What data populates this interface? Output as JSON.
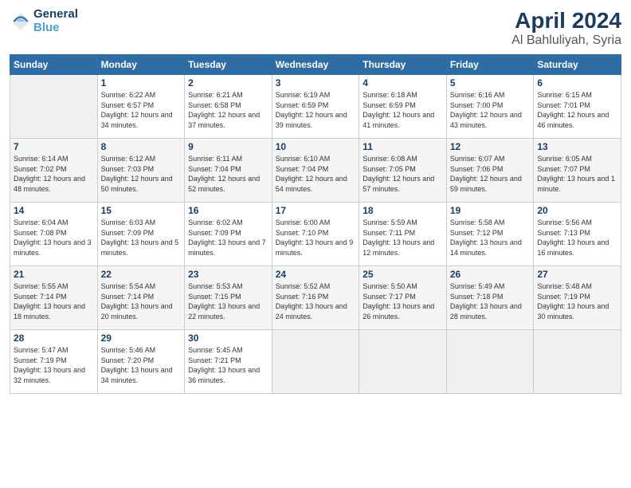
{
  "header": {
    "logo_line1": "General",
    "logo_line2": "Blue",
    "month_title": "April 2024",
    "location": "Al Bahluliyah, Syria"
  },
  "weekdays": [
    "Sunday",
    "Monday",
    "Tuesday",
    "Wednesday",
    "Thursday",
    "Friday",
    "Saturday"
  ],
  "weeks": [
    [
      {
        "day": "",
        "sunrise": "",
        "sunset": "",
        "daylight": ""
      },
      {
        "day": "1",
        "sunrise": "Sunrise: 6:22 AM",
        "sunset": "Sunset: 6:57 PM",
        "daylight": "Daylight: 12 hours and 34 minutes."
      },
      {
        "day": "2",
        "sunrise": "Sunrise: 6:21 AM",
        "sunset": "Sunset: 6:58 PM",
        "daylight": "Daylight: 12 hours and 37 minutes."
      },
      {
        "day": "3",
        "sunrise": "Sunrise: 6:19 AM",
        "sunset": "Sunset: 6:59 PM",
        "daylight": "Daylight: 12 hours and 39 minutes."
      },
      {
        "day": "4",
        "sunrise": "Sunrise: 6:18 AM",
        "sunset": "Sunset: 6:59 PM",
        "daylight": "Daylight: 12 hours and 41 minutes."
      },
      {
        "day": "5",
        "sunrise": "Sunrise: 6:16 AM",
        "sunset": "Sunset: 7:00 PM",
        "daylight": "Daylight: 12 hours and 43 minutes."
      },
      {
        "day": "6",
        "sunrise": "Sunrise: 6:15 AM",
        "sunset": "Sunset: 7:01 PM",
        "daylight": "Daylight: 12 hours and 46 minutes."
      }
    ],
    [
      {
        "day": "7",
        "sunrise": "Sunrise: 6:14 AM",
        "sunset": "Sunset: 7:02 PM",
        "daylight": "Daylight: 12 hours and 48 minutes."
      },
      {
        "day": "8",
        "sunrise": "Sunrise: 6:12 AM",
        "sunset": "Sunset: 7:03 PM",
        "daylight": "Daylight: 12 hours and 50 minutes."
      },
      {
        "day": "9",
        "sunrise": "Sunrise: 6:11 AM",
        "sunset": "Sunset: 7:04 PM",
        "daylight": "Daylight: 12 hours and 52 minutes."
      },
      {
        "day": "10",
        "sunrise": "Sunrise: 6:10 AM",
        "sunset": "Sunset: 7:04 PM",
        "daylight": "Daylight: 12 hours and 54 minutes."
      },
      {
        "day": "11",
        "sunrise": "Sunrise: 6:08 AM",
        "sunset": "Sunset: 7:05 PM",
        "daylight": "Daylight: 12 hours and 57 minutes."
      },
      {
        "day": "12",
        "sunrise": "Sunrise: 6:07 AM",
        "sunset": "Sunset: 7:06 PM",
        "daylight": "Daylight: 12 hours and 59 minutes."
      },
      {
        "day": "13",
        "sunrise": "Sunrise: 6:05 AM",
        "sunset": "Sunset: 7:07 PM",
        "daylight": "Daylight: 13 hours and 1 minute."
      }
    ],
    [
      {
        "day": "14",
        "sunrise": "Sunrise: 6:04 AM",
        "sunset": "Sunset: 7:08 PM",
        "daylight": "Daylight: 13 hours and 3 minutes."
      },
      {
        "day": "15",
        "sunrise": "Sunrise: 6:03 AM",
        "sunset": "Sunset: 7:09 PM",
        "daylight": "Daylight: 13 hours and 5 minutes."
      },
      {
        "day": "16",
        "sunrise": "Sunrise: 6:02 AM",
        "sunset": "Sunset: 7:09 PM",
        "daylight": "Daylight: 13 hours and 7 minutes."
      },
      {
        "day": "17",
        "sunrise": "Sunrise: 6:00 AM",
        "sunset": "Sunset: 7:10 PM",
        "daylight": "Daylight: 13 hours and 9 minutes."
      },
      {
        "day": "18",
        "sunrise": "Sunrise: 5:59 AM",
        "sunset": "Sunset: 7:11 PM",
        "daylight": "Daylight: 13 hours and 12 minutes."
      },
      {
        "day": "19",
        "sunrise": "Sunrise: 5:58 AM",
        "sunset": "Sunset: 7:12 PM",
        "daylight": "Daylight: 13 hours and 14 minutes."
      },
      {
        "day": "20",
        "sunrise": "Sunrise: 5:56 AM",
        "sunset": "Sunset: 7:13 PM",
        "daylight": "Daylight: 13 hours and 16 minutes."
      }
    ],
    [
      {
        "day": "21",
        "sunrise": "Sunrise: 5:55 AM",
        "sunset": "Sunset: 7:14 PM",
        "daylight": "Daylight: 13 hours and 18 minutes."
      },
      {
        "day": "22",
        "sunrise": "Sunrise: 5:54 AM",
        "sunset": "Sunset: 7:14 PM",
        "daylight": "Daylight: 13 hours and 20 minutes."
      },
      {
        "day": "23",
        "sunrise": "Sunrise: 5:53 AM",
        "sunset": "Sunset: 7:15 PM",
        "daylight": "Daylight: 13 hours and 22 minutes."
      },
      {
        "day": "24",
        "sunrise": "Sunrise: 5:52 AM",
        "sunset": "Sunset: 7:16 PM",
        "daylight": "Daylight: 13 hours and 24 minutes."
      },
      {
        "day": "25",
        "sunrise": "Sunrise: 5:50 AM",
        "sunset": "Sunset: 7:17 PM",
        "daylight": "Daylight: 13 hours and 26 minutes."
      },
      {
        "day": "26",
        "sunrise": "Sunrise: 5:49 AM",
        "sunset": "Sunset: 7:18 PM",
        "daylight": "Daylight: 13 hours and 28 minutes."
      },
      {
        "day": "27",
        "sunrise": "Sunrise: 5:48 AM",
        "sunset": "Sunset: 7:19 PM",
        "daylight": "Daylight: 13 hours and 30 minutes."
      }
    ],
    [
      {
        "day": "28",
        "sunrise": "Sunrise: 5:47 AM",
        "sunset": "Sunset: 7:19 PM",
        "daylight": "Daylight: 13 hours and 32 minutes."
      },
      {
        "day": "29",
        "sunrise": "Sunrise: 5:46 AM",
        "sunset": "Sunset: 7:20 PM",
        "daylight": "Daylight: 13 hours and 34 minutes."
      },
      {
        "day": "30",
        "sunrise": "Sunrise: 5:45 AM",
        "sunset": "Sunset: 7:21 PM",
        "daylight": "Daylight: 13 hours and 36 minutes."
      },
      {
        "day": "",
        "sunrise": "",
        "sunset": "",
        "daylight": ""
      },
      {
        "day": "",
        "sunrise": "",
        "sunset": "",
        "daylight": ""
      },
      {
        "day": "",
        "sunrise": "",
        "sunset": "",
        "daylight": ""
      },
      {
        "day": "",
        "sunrise": "",
        "sunset": "",
        "daylight": ""
      }
    ]
  ]
}
